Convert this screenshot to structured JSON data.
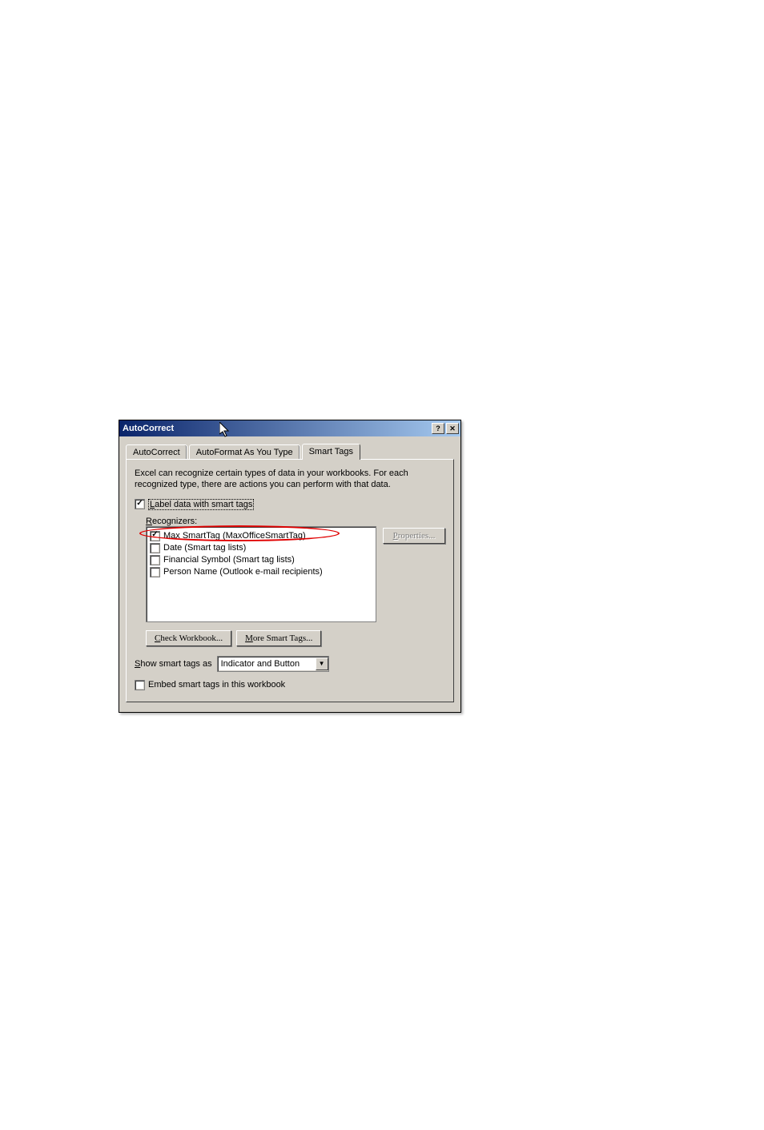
{
  "dialog": {
    "title": "AutoCorrect",
    "tabs": {
      "autocorrect": "AutoCorrect",
      "autoformat": "AutoFormat As You Type",
      "smarttags": "Smart Tags"
    },
    "intro": "Excel can recognize certain types of data in your workbooks.  For each recognized type, there are actions you can perform with that data.",
    "labelData": {
      "prefix": "",
      "mnemonic": "L",
      "rest": "abel data with smart tags",
      "checked": true
    },
    "recognizers": {
      "label_prefix": "",
      "label_mnemonic": "R",
      "label_rest": "ecognizers:",
      "items": [
        {
          "label": "Max SmartTag (MaxOfficeSmartTag)",
          "checked": true,
          "highlighted": true
        },
        {
          "label": "Date (Smart tag lists)",
          "checked": false
        },
        {
          "label": "Financial Symbol (Smart tag lists)",
          "checked": false
        },
        {
          "label": "Person Name (Outlook e-mail recipients)",
          "checked": false
        }
      ]
    },
    "buttons": {
      "properties_mnemonic": "P",
      "properties_rest": "roperties...",
      "check_workbook_mnemonic": "C",
      "check_workbook_rest": "heck Workbook...",
      "more_smart_tags_mnemonic": "M",
      "more_smart_tags_rest": "ore Smart Tags..."
    },
    "show_as": {
      "label_mnemonic": "S",
      "label_rest": "how smart tags as",
      "value": "Indicator and Button"
    },
    "embed": {
      "label": "Embed smart tags in this workbook",
      "checked": false
    }
  }
}
